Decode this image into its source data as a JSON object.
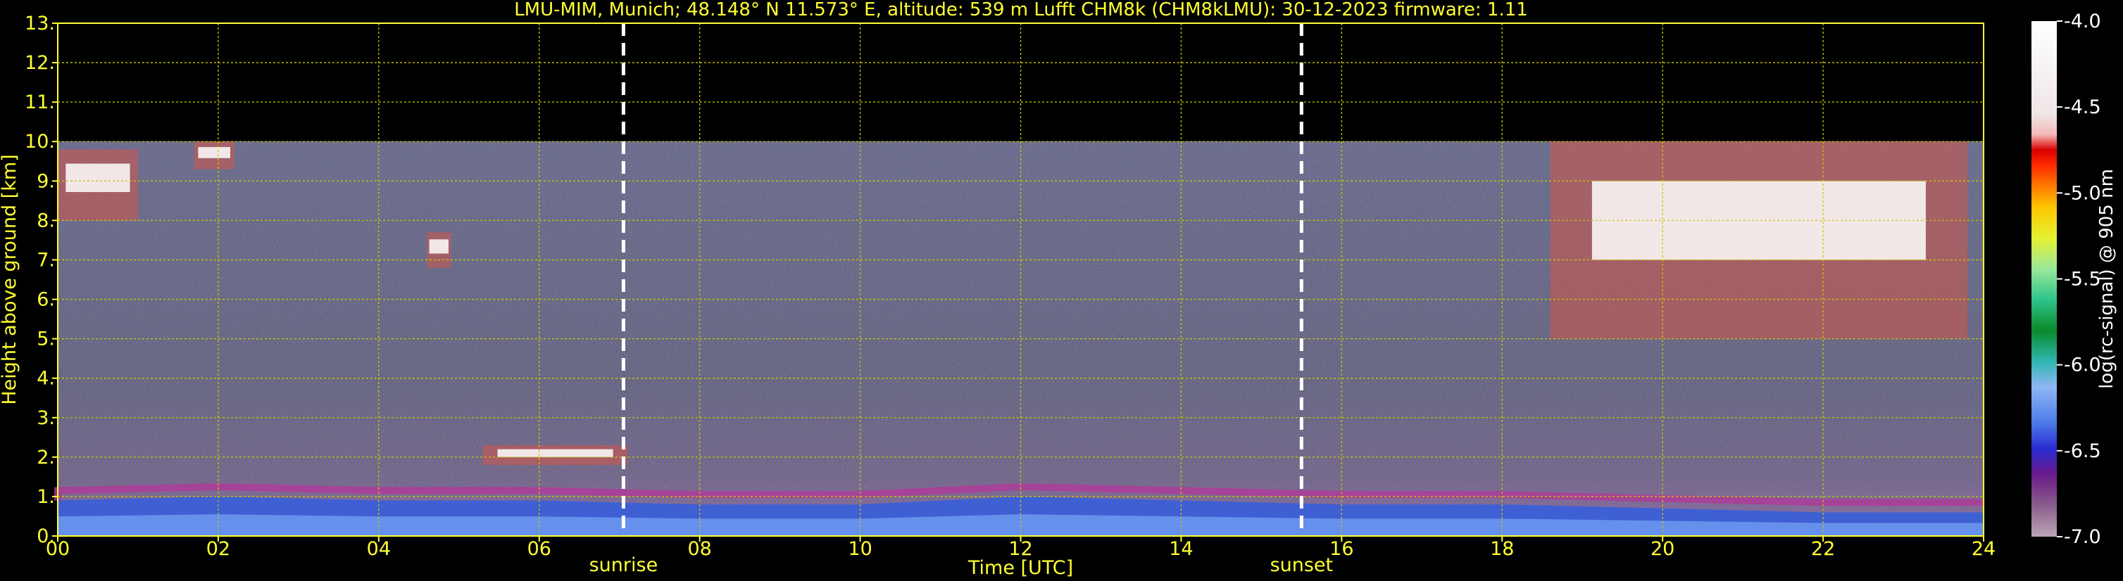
{
  "chart_data": {
    "type": "heatmap",
    "title": "LMU-MIM, Munich; 48.148° N 11.573° E, altitude: 539 m    Lufft CHM8k (CHM8kLMU): 30-12-2023    firmware: 1.11",
    "xlabel": "Time [UTC]",
    "ylabel": "Height above ground [km]",
    "xlim": [
      0,
      24
    ],
    "ylim": [
      0,
      13
    ],
    "x_ticks": [
      "00",
      "02",
      "04",
      "06",
      "08",
      "10",
      "12",
      "14",
      "16",
      "18",
      "20",
      "22",
      "24"
    ],
    "y_ticks": [
      "0.",
      "1.",
      "2.",
      "3.",
      "4.",
      "5.",
      "6.",
      "7.",
      "8.",
      "9.",
      "10.",
      "11.",
      "12.",
      "13."
    ],
    "grid": true,
    "data_top_km": 10,
    "markers": [
      {
        "label": "sunrise",
        "x": 7.05
      },
      {
        "label": "sunset",
        "x": 15.5
      }
    ],
    "colorbar": {
      "label": "log(rc-signal) @ 905 nm",
      "min": -7.0,
      "max": -4.0,
      "ticks": [
        "-4.0",
        "-4.5",
        "-5.0",
        "-5.5",
        "-6.0",
        "-6.5",
        "-7.0"
      ]
    },
    "boundary_layer": [
      {
        "x": 0,
        "top": 0.9
      },
      {
        "x": 2,
        "top": 1.0
      },
      {
        "x": 4,
        "top": 0.9
      },
      {
        "x": 6,
        "top": 0.9
      },
      {
        "x": 8,
        "top": 0.8
      },
      {
        "x": 10,
        "top": 0.8
      },
      {
        "x": 12,
        "top": 1.0
      },
      {
        "x": 14,
        "top": 0.9
      },
      {
        "x": 16,
        "top": 0.8
      },
      {
        "x": 18,
        "top": 0.8
      },
      {
        "x": 20,
        "top": 0.7
      },
      {
        "x": 22,
        "top": 0.6
      },
      {
        "x": 24,
        "top": 0.6
      }
    ],
    "cloud_layers": [
      {
        "x0": 5.3,
        "x1": 7.1,
        "y0": 1.8,
        "y1": 2.3
      },
      {
        "x0": 0.0,
        "x1": 1.0,
        "y0": 8.0,
        "y1": 9.8
      },
      {
        "x0": 1.7,
        "x1": 2.2,
        "y0": 9.3,
        "y1": 10.0
      },
      {
        "x0": 4.6,
        "x1": 4.9,
        "y0": 6.8,
        "y1": 7.7
      },
      {
        "x0": 18.6,
        "x1": 23.8,
        "y0": 5.0,
        "y1": 10.0
      }
    ]
  }
}
